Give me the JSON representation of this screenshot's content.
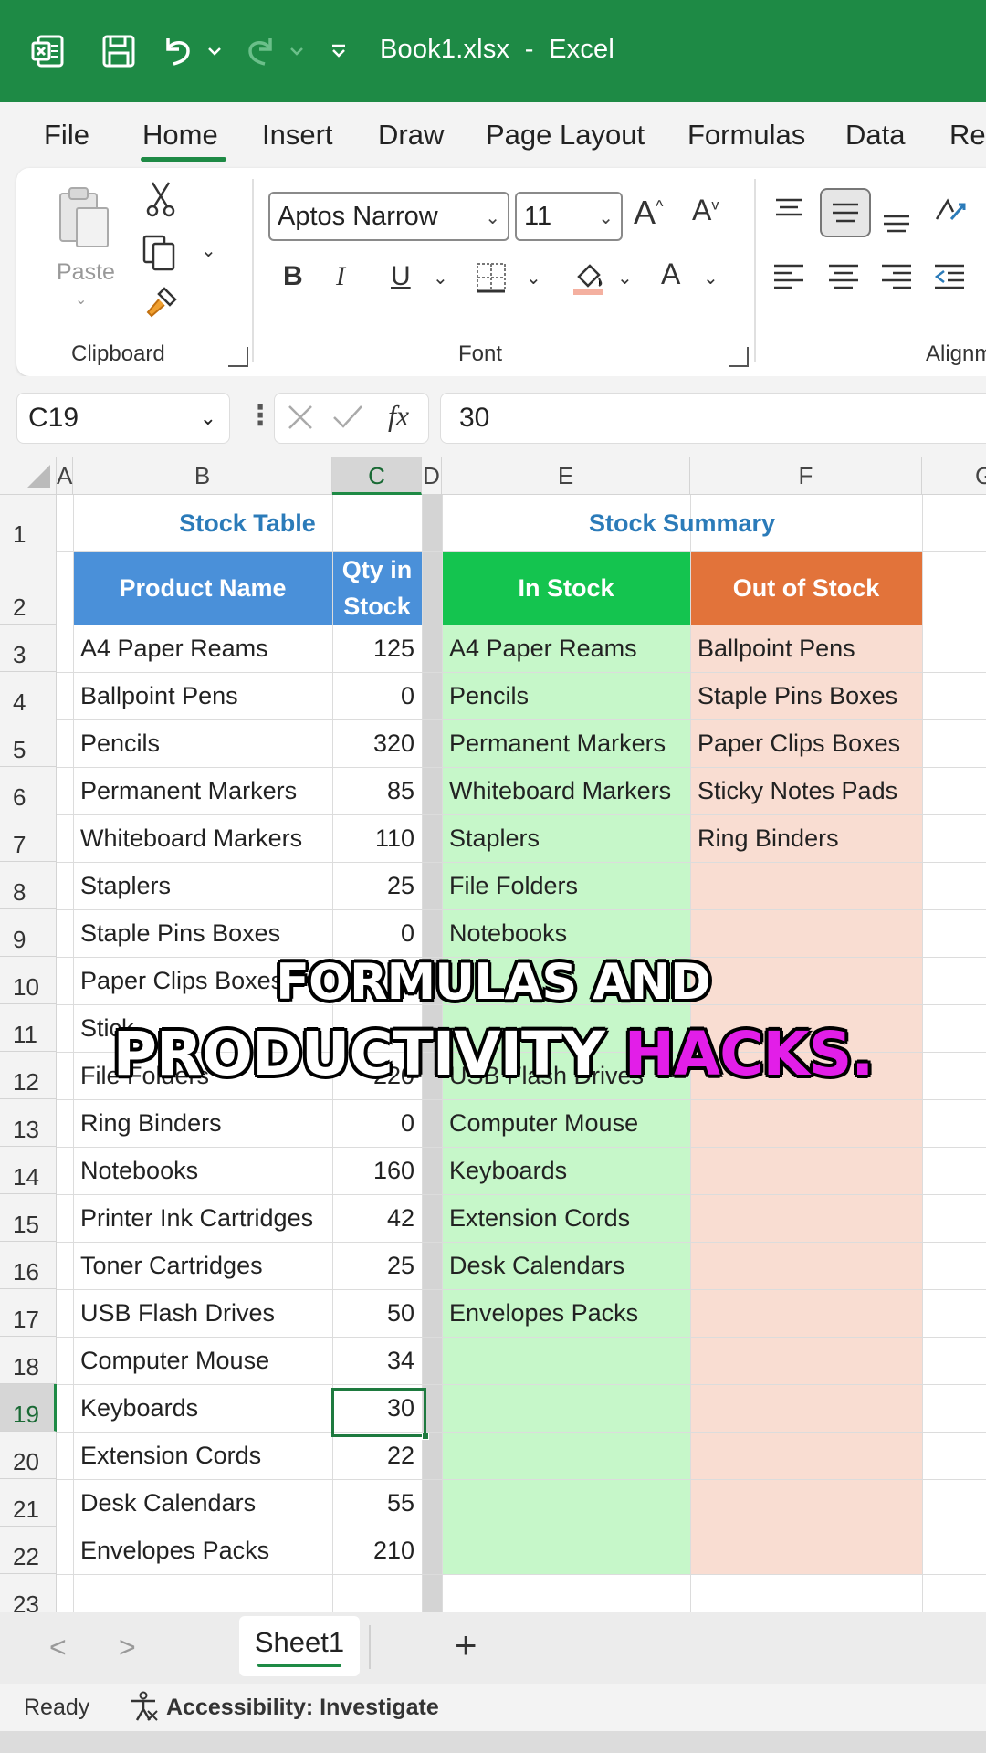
{
  "titlebar": {
    "title": "Book1.xlsx  -  Excel",
    "icons": [
      "excel-logo-icon",
      "save-icon",
      "undo-icon",
      "redo-icon",
      "customize-quick-access-icon"
    ]
  },
  "menu": {
    "tabs": [
      "File",
      "Home",
      "Insert",
      "Draw",
      "Page Layout",
      "Formulas",
      "Data",
      "Re"
    ],
    "active": "Home"
  },
  "ribbon": {
    "paste_label": "Paste",
    "clipboard_label": "Clipboard",
    "font_label": "Font",
    "alignment_label": "Alignm",
    "font_name": "Aptos Narrow",
    "font_size": "11",
    "increase_font": "A",
    "decrease_font": "A",
    "bold": "B",
    "italic": "I",
    "underline": "U",
    "font_color": "A"
  },
  "formula_bar": {
    "name_box": "C19",
    "fx": "fx",
    "value": "30"
  },
  "grid": {
    "columns": [
      "A",
      "B",
      "C",
      "D",
      "E",
      "F",
      "G"
    ],
    "selected_column": "C",
    "selected_row": "19",
    "rows": [
      "1",
      "2",
      "3",
      "4",
      "5",
      "6",
      "7",
      "8",
      "9",
      "10",
      "11",
      "12",
      "13",
      "14",
      "15",
      "16",
      "17",
      "18",
      "19",
      "20",
      "21",
      "22",
      "23"
    ],
    "stock_table_title": "Stock Table",
    "stock_summary_title": "Stock Summary",
    "header_product": "Product Name",
    "header_qty_line1": "Qty in",
    "header_qty_line2": "Stock",
    "header_in_stock": "In Stock",
    "header_out_stock": "Out of Stock",
    "products": [
      {
        "name": "A4 Paper Reams",
        "qty": "125"
      },
      {
        "name": "Ballpoint Pens",
        "qty": "0"
      },
      {
        "name": "Pencils",
        "qty": "320"
      },
      {
        "name": "Permanent Markers",
        "qty": "85"
      },
      {
        "name": "Whiteboard Markers",
        "qty": "110"
      },
      {
        "name": "Staplers",
        "qty": "25"
      },
      {
        "name": "Staple Pins Boxes",
        "qty": "0"
      },
      {
        "name": "Paper Clips Boxes",
        "qty": ""
      },
      {
        "name": "Stick",
        "qty": ""
      },
      {
        "name": "File Folders",
        "qty": "220"
      },
      {
        "name": "Ring Binders",
        "qty": "0"
      },
      {
        "name": "Notebooks",
        "qty": "160"
      },
      {
        "name": "Printer Ink Cartridges",
        "qty": "42"
      },
      {
        "name": "Toner Cartridges",
        "qty": "25"
      },
      {
        "name": "USB Flash Drives",
        "qty": "50"
      },
      {
        "name": "Computer Mouse",
        "qty": "34"
      },
      {
        "name": "Keyboards",
        "qty": "30"
      },
      {
        "name": "Extension Cords",
        "qty": "22"
      },
      {
        "name": "Desk Calendars",
        "qty": "55"
      },
      {
        "name": "Envelopes Packs",
        "qty": "210"
      }
    ],
    "in_stock": [
      "A4 Paper Reams",
      "Pencils",
      "Permanent Markers",
      "Whiteboard Markers",
      "Staplers",
      "File Folders",
      "Notebooks",
      "",
      "",
      "USB Flash Drives",
      "Computer Mouse",
      "Keyboards",
      "Extension Cords",
      "Desk Calendars",
      "Envelopes Packs"
    ],
    "out_of_stock": [
      "Ballpoint Pens",
      "Staple Pins Boxes",
      "Paper Clips Boxes",
      "Sticky Notes Pads",
      "Ring Binders"
    ]
  },
  "caption": {
    "line1": "FORMULAS AND",
    "line2_white": "PRODUCTIVITY ",
    "line2_highlight": "HACKS."
  },
  "sheets": {
    "active": "Sheet1",
    "add": "+",
    "prev": "<",
    "next": ">"
  },
  "status": {
    "ready": "Ready",
    "accessibility": "Accessibility: Investigate"
  },
  "colors": {
    "excel_green": "#1e8a45",
    "header_blue": "#4a90d9",
    "in_stock_header": "#14c44f",
    "out_stock_header": "#e2733a",
    "in_stock_fill": "#c6f7c9",
    "out_stock_fill": "#f9ddd2",
    "title_blue": "#2b7bb9",
    "caption_highlight": "#e21ee8"
  }
}
